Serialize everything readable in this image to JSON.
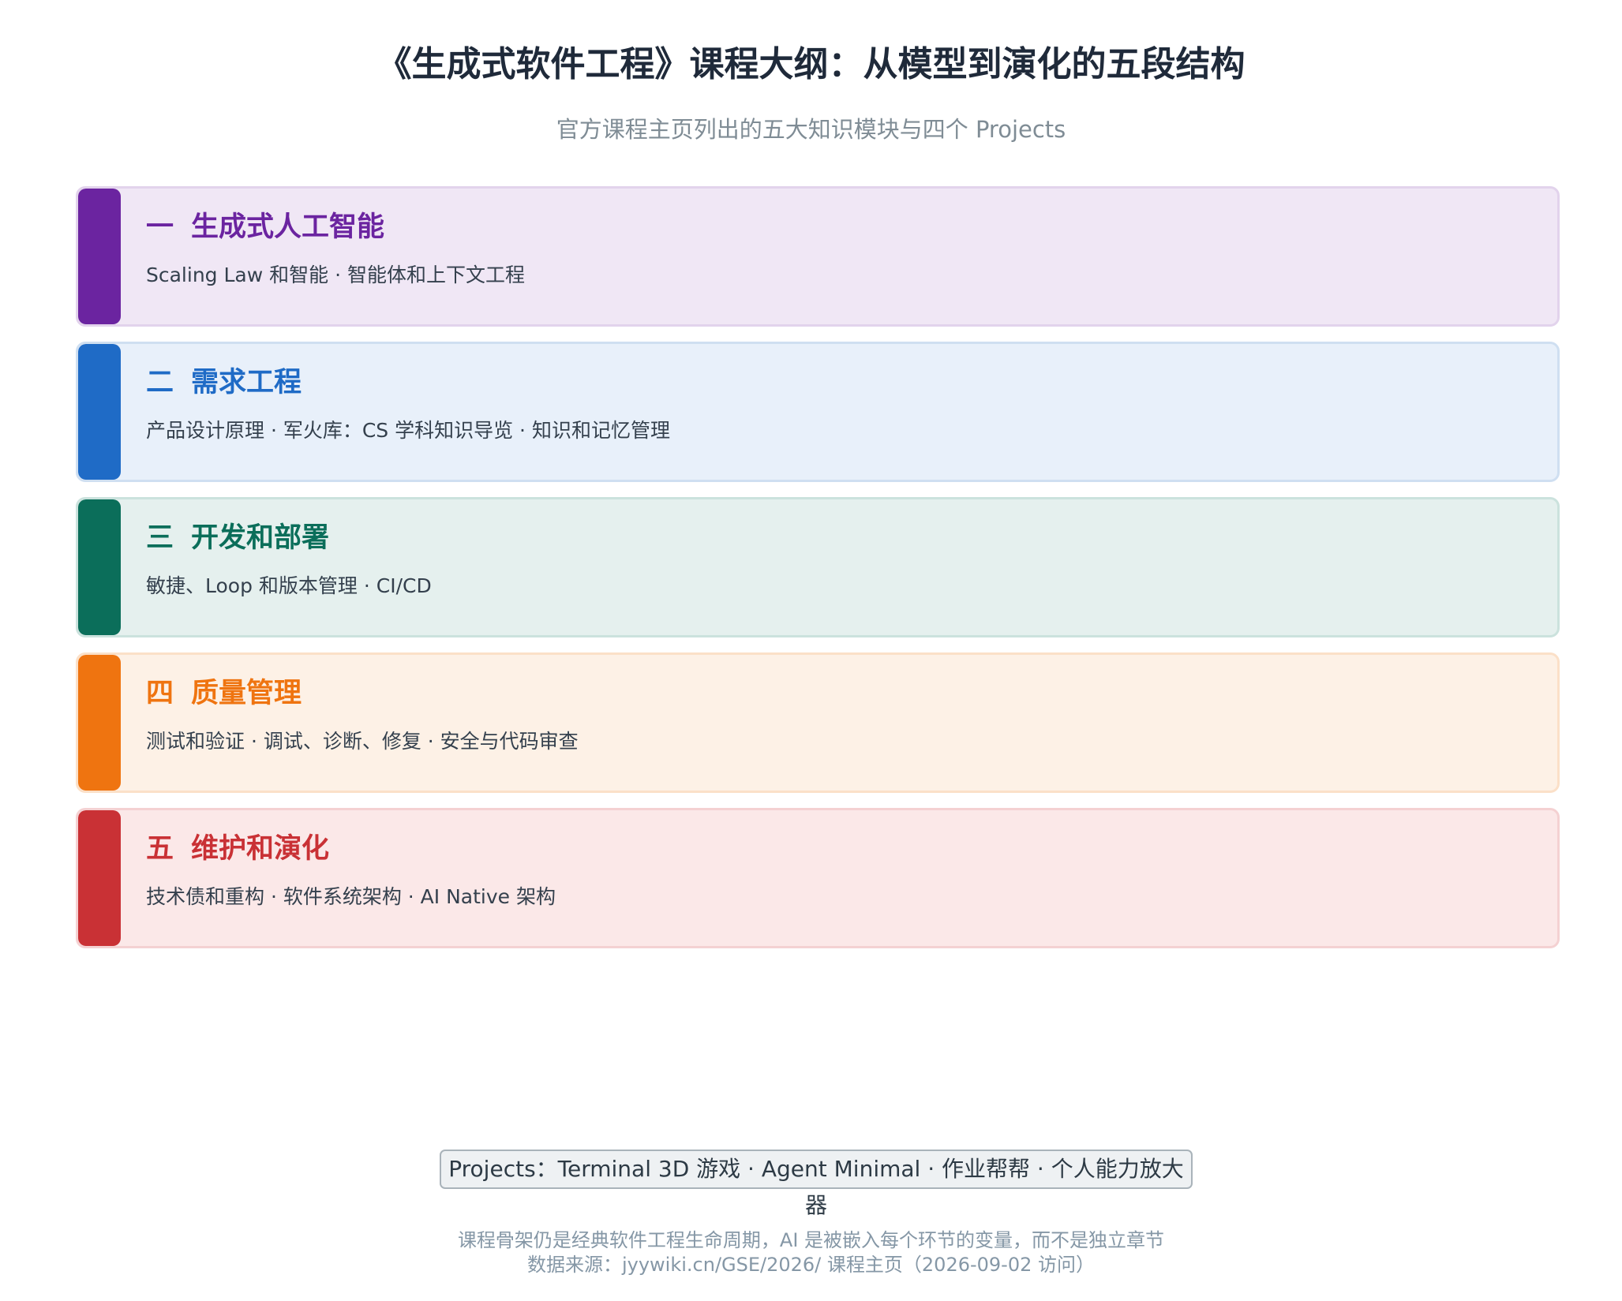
{
  "title": "《生成式软件工程》课程大纲：从模型到演化的五段结构",
  "subtitle": "官方课程主页列出的五大知识模块与四个 Projects",
  "modules": [
    {
      "num": "一",
      "name": "生成式人工智能",
      "desc": "Scaling Law 和智能 · 智能体和上下文工程",
      "accent": "#6b24a0",
      "bg": "#f0e7f5",
      "border": "#e2d3ec"
    },
    {
      "num": "二",
      "name": "需求工程",
      "desc": "产品设计原理 · 军火库：CS 学科知识导览 · 知识和记忆管理",
      "accent": "#1f6bc6",
      "bg": "#e8f0fa",
      "border": "#cfdff1"
    },
    {
      "num": "三",
      "name": "开发和部署",
      "desc": "敏捷、Loop 和版本管理 · CI/CD",
      "accent": "#0b6e5a",
      "bg": "#e5f0ee",
      "border": "#cbe2dd"
    },
    {
      "num": "四",
      "name": "质量管理",
      "desc": "测试和验证 · 调试、诊断、修复 · 安全与代码审查",
      "accent": "#ef7410",
      "bg": "#fdf1e6",
      "border": "#fbe0c8"
    },
    {
      "num": "五",
      "name": "维护和演化",
      "desc": "技术债和重构 · 软件系统架构 · AI Native 架构",
      "accent": "#c93135",
      "bg": "#fbe8e8",
      "border": "#f4d1d2"
    }
  ],
  "projects": "Projects：Terminal 3D 游戏 · Agent Minimal · 作业帮帮 · 个人能力放大器",
  "note": "课程骨架仍是经典软件工程生命周期，AI 是被嵌入每个环节的变量，而不是独立章节",
  "source": "数据来源：jyywiki.cn/GSE/2026/ 课程主页（2026-09-02 访问）"
}
